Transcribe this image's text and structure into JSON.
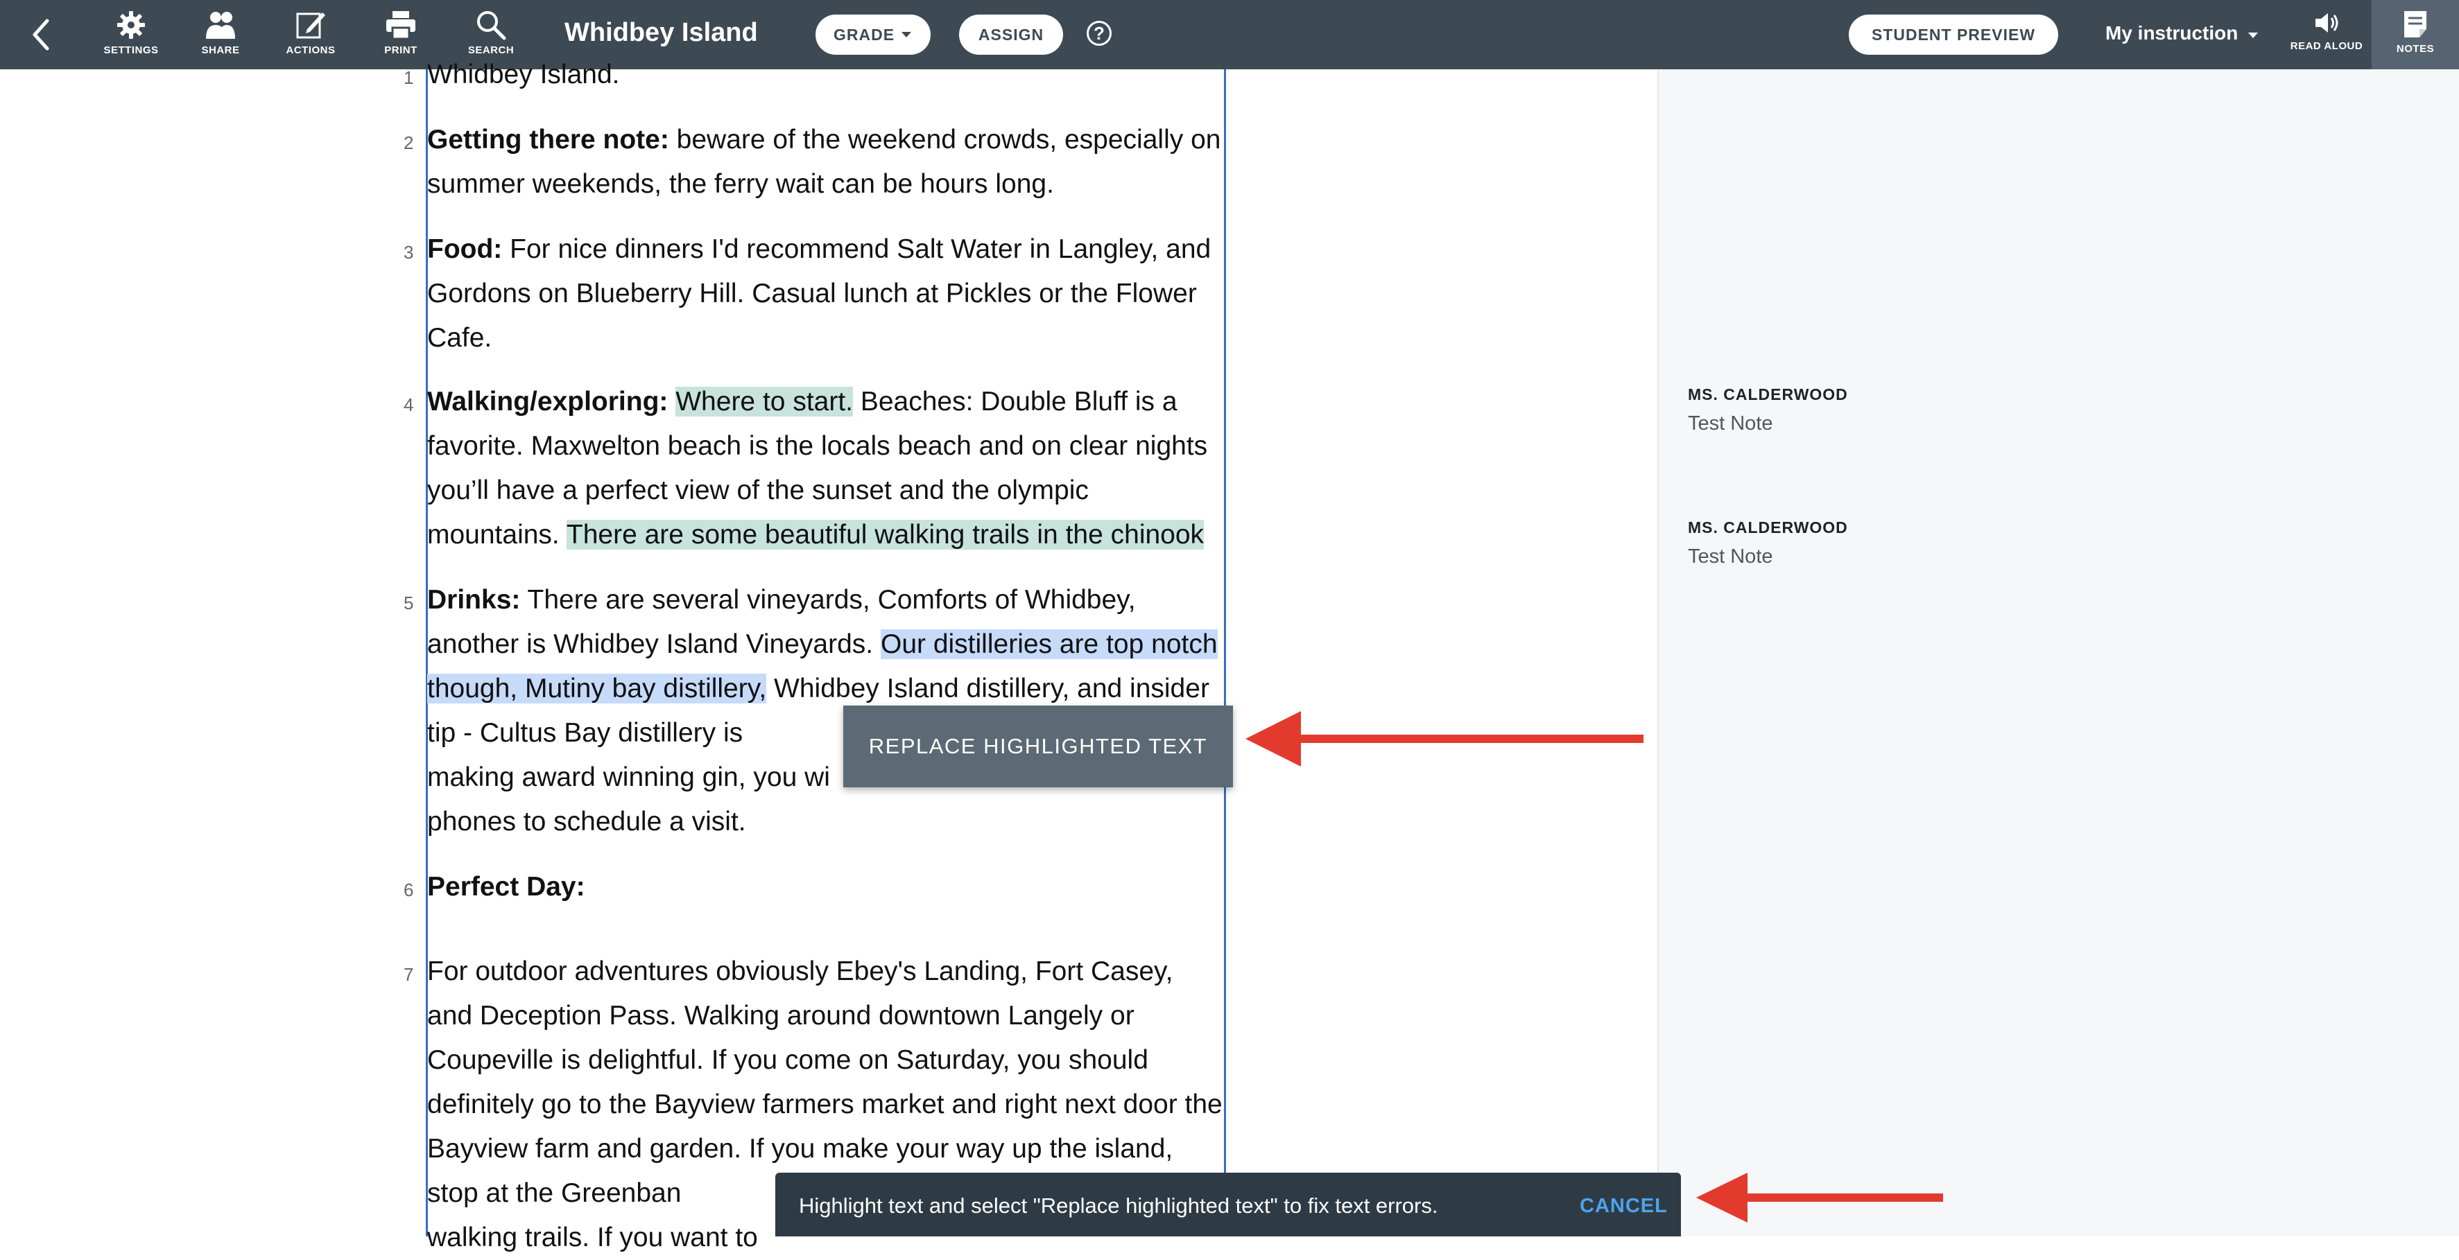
{
  "toolbar": {
    "back_icon": "chevron-left-icon",
    "items": [
      {
        "label": "SETTINGS",
        "icon": "gear-icon"
      },
      {
        "label": "SHARE",
        "icon": "people-icon"
      },
      {
        "label": "ACTIONS",
        "icon": "edit-icon"
      },
      {
        "label": "PRINT",
        "icon": "printer-icon"
      },
      {
        "label": "SEARCH",
        "icon": "search-icon"
      }
    ],
    "title": "Whidbey Island",
    "grade_label": "GRADE",
    "assign_label": "ASSIGN",
    "help_label": "?",
    "student_preview_label": "STUDENT PREVIEW",
    "instruction_label": "My instruction",
    "read_aloud_label": "READ ALOUD",
    "notes_label": "NOTES",
    "colors": {
      "bar": "#3d4a54",
      "active_tab": "#556470"
    }
  },
  "document": {
    "p1": {
      "num": "1",
      "text": "Whidbey Island."
    },
    "p2": {
      "num": "2",
      "bold": "Getting there note:",
      "text": " beware of the weekend crowds, especially on summer weekends, the ferry wait can be hours long."
    },
    "p3": {
      "num": "3",
      "bold": "Food:",
      "text": " For nice dinners I'd recommend Salt Water in Langley, and Gordons on Blueberry Hill. Casual lunch at Pickles or the Flower Cafe."
    },
    "p4": {
      "num": "4",
      "bold": "Walking/exploring:",
      "gap": " ",
      "hl1": "Where to start.",
      "text": " Beaches: Double Bluff is a favorite. Maxwelton beach is the locals beach and on clear nights you’ll have a perfect view of the sunset and the olympic mountains. ",
      "hl2": "There are some beautiful walking trails in the chinook"
    },
    "p5": {
      "num": "5",
      "bold": "Drinks:",
      "text1": " There are several vineyards, Comforts of Whidbey, another is Whidbey Island Vineyards. ",
      "hl": "Our distilleries are top notch though, Mutiny bay distillery,",
      "text2": " Whidbey Island distillery, and insider tip - Cultus Bay distillery is",
      "line_a": "making award winning gin, you wi",
      "line_b": "phones to schedule a visit."
    },
    "p6": {
      "num": "6",
      "bold": "Perfect Day:"
    },
    "p7": {
      "num": "7",
      "text": "For outdoor adventures obviously Ebey's Landing, Fort Casey, and Deception Pass. Walking around downtown Langely or Coupeville is delightful. If you come on Saturday, you should definitely go to the Bayview farmers market and right next door the Bayview farm and garden. If you make your way up the island, stop at the Greenban",
      "tail": "walking trails. If you want to"
    },
    "colors": {
      "highlight_green": "#c7e3dc",
      "highlight_blue": "#c6dafa",
      "frame": "#3b6bc4"
    }
  },
  "notes": [
    {
      "author": "MS. CALDERWOOD",
      "text": "Test Note"
    },
    {
      "author": "MS. CALDERWOOD",
      "text": "Test Note"
    }
  ],
  "popup": {
    "replace_label": "REPLACE HIGHLIGHTED TEXT"
  },
  "snackbar": {
    "message": "Highlight text and select \"Replace highlighted text\" to fix text errors.",
    "cancel_label": "CANCEL"
  },
  "annotations": {
    "arrow_color": "#e23b2e"
  }
}
